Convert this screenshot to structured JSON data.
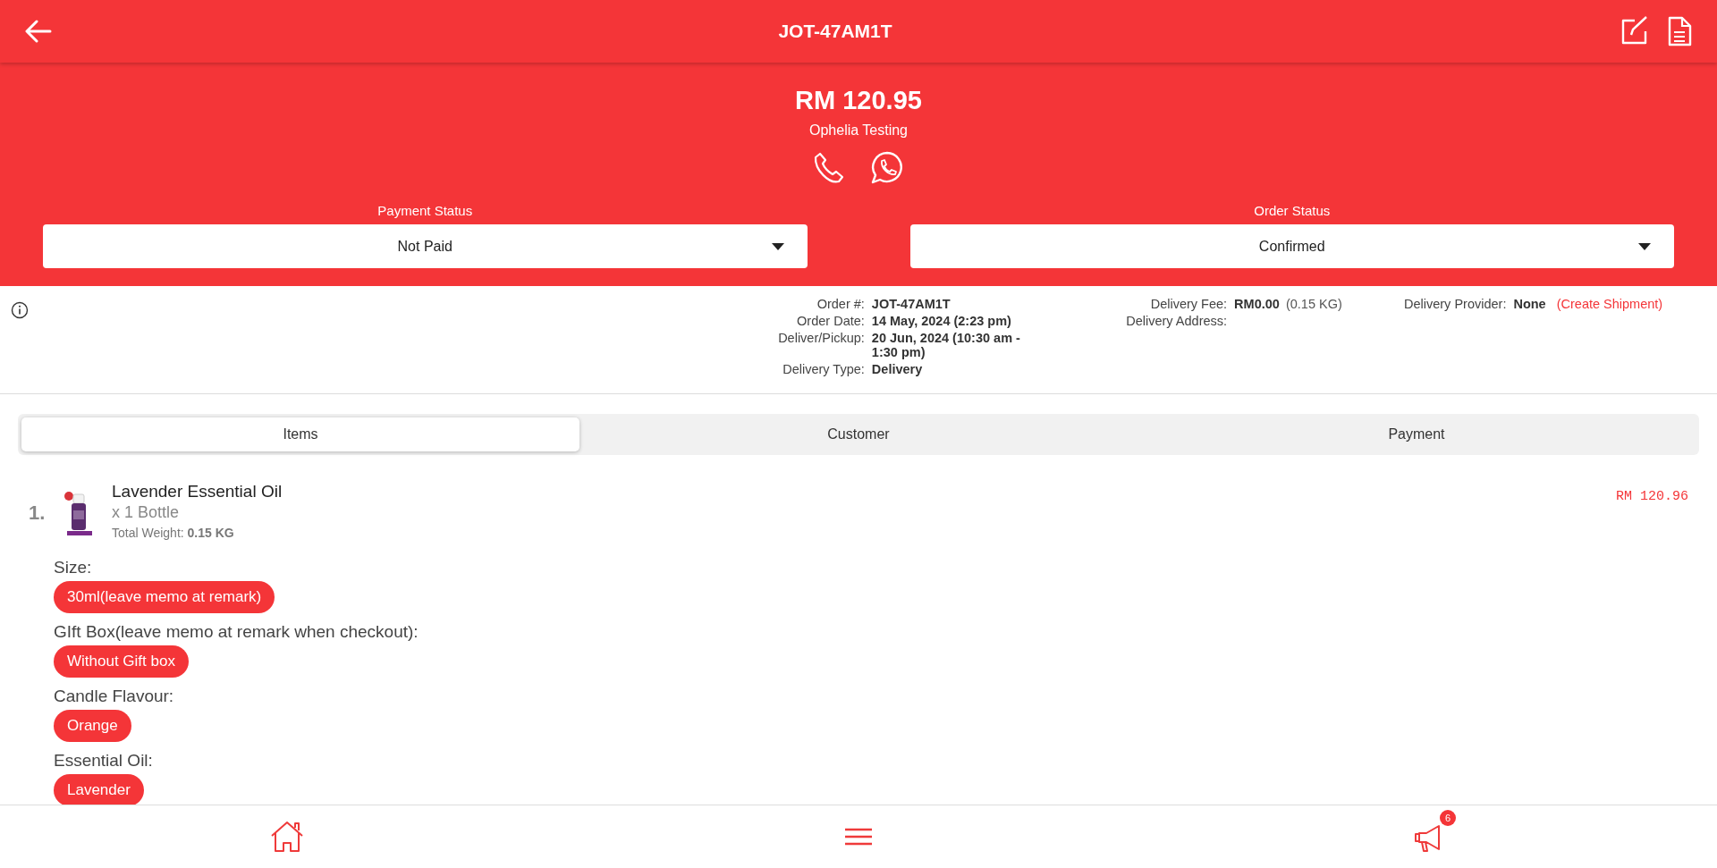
{
  "header": {
    "title": "JOT-47AM1T"
  },
  "summary": {
    "amount": "RM 120.95",
    "customer": "Ophelia Testing"
  },
  "statuses": [
    {
      "label": "Payment Status",
      "value": "Not Paid"
    },
    {
      "label": "Order Status",
      "value": "Confirmed"
    }
  ],
  "info_columns": [
    [
      {
        "label": "Order #:",
        "value": "JOT-47AM1T"
      },
      {
        "label": "Order Date:",
        "value": "14 May, 2024 (2:23 pm)"
      },
      {
        "label": "Deliver/Pickup:",
        "value": "20 Jun, 2024 (10:30 am - 1:30 pm)"
      },
      {
        "label": "Delivery Type:",
        "value": "Delivery"
      }
    ],
    [
      {
        "label": "Delivery Fee:",
        "value": "RM0.00",
        "note": "(0.15 KG)"
      },
      {
        "label": "Delivery Address:"
      }
    ],
    [
      {
        "label": "Delivery Provider:",
        "value": "None",
        "link": "(Create Shipment)"
      }
    ]
  ],
  "tabs": [
    {
      "label": "Items",
      "selected": true
    },
    {
      "label": "Customer",
      "selected": false
    },
    {
      "label": "Payment",
      "selected": false
    }
  ],
  "items": [
    {
      "index": "1.",
      "name": "Lavender Essential Oil",
      "quantity": "x 1 Bottle",
      "weight_label": "Total Weight:",
      "weight": "0.15 KG",
      "price": "RM 120.96",
      "options": [
        {
          "label": "Size:",
          "values": [
            "30ml(leave memo at remark)"
          ]
        },
        {
          "label": "GIft Box(leave memo at remark when checkout):",
          "values": [
            "Without Gift box"
          ]
        },
        {
          "label": "Candle Flavour:",
          "values": [
            "Orange"
          ]
        },
        {
          "label": "Essential Oil:",
          "values": [
            "Lavender"
          ]
        }
      ]
    }
  ],
  "nav": {
    "badge": "6"
  }
}
